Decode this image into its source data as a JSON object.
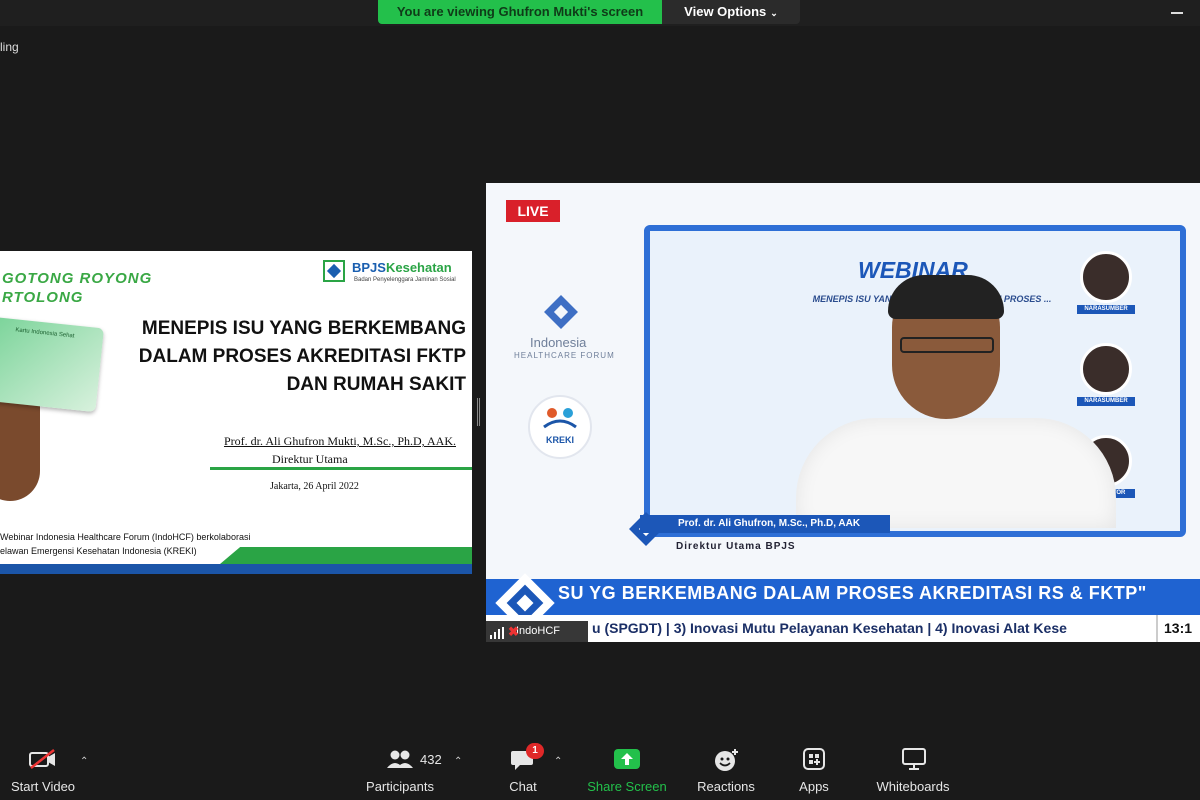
{
  "topbar": {
    "viewing_banner": "You are viewing Ghufron Mukti's screen",
    "view_options": "View Options",
    "left_fragment": "ling"
  },
  "slide": {
    "tagline": "GOTONG ROYONG\nRTOLONG",
    "card_text": "Kartu Indonesia Sehat",
    "brand_name": "BPJS",
    "brand_name_accent": "Kesehatan",
    "brand_sub": "Badan Penyelenggara Jaminan Sosial",
    "title_lines": [
      "MENEPIS ISU YANG BERKEMBANG",
      "DALAM PROSES AKREDITASI FKTP",
      "DAN RUMAH SAKIT"
    ],
    "speaker": "Prof. dr. Ali Ghufron Mukti, M.Sc., Ph.D, AAK.",
    "speaker_role": "Direktur  Utama",
    "date": "Jakarta, 26 April 2022",
    "collab_lines": [
      "Webinar Indonesia Healthcare Forum (IndoHCF) berkolaborasi",
      "elawan Emergensi Kesehatan Indonesia (KREKI)"
    ]
  },
  "video": {
    "live_label": "LIVE",
    "org_name": "Indonesia",
    "org_sub": "HEALTHCARE FORUM",
    "kreki_label": "KREKI",
    "webinar_title": "WEBINAR",
    "webinar_sub": "MENEPIS ISU YANG BERKEMBANG DALAM PROSES ... FKTP",
    "narasumber_tags": [
      "NARASUMBER",
      "NARASUMBER",
      "MODERATOR"
    ],
    "presenter_name": "Prof. dr. Ali Ghufron, M.Sc., Ph.D, AAK",
    "presenter_role": "Direktur Utama BPJS",
    "banner_text": "SU YG BERKEMBANG DALAM PROSES AKREDITASI RS & FKTP\"",
    "ticker_text": "u (SPGDT) | 3) Inovasi Mutu Pelayanan Kesehatan | 4) Inovasi Alat Kese",
    "clock": "13:1",
    "participant_name": "IndoHCF"
  },
  "toolbar": {
    "start_video": "Start Video",
    "participants": "Participants",
    "participants_count": "432",
    "chat": "Chat",
    "chat_badge": "1",
    "share_screen": "Share Screen",
    "reactions": "Reactions",
    "apps": "Apps",
    "whiteboards": "Whiteboards"
  },
  "colors": {
    "viewing_green": "#23c04b",
    "live_red": "#d9202a",
    "banner_blue": "#1f63d1",
    "bpjs_green": "#2aa445"
  }
}
